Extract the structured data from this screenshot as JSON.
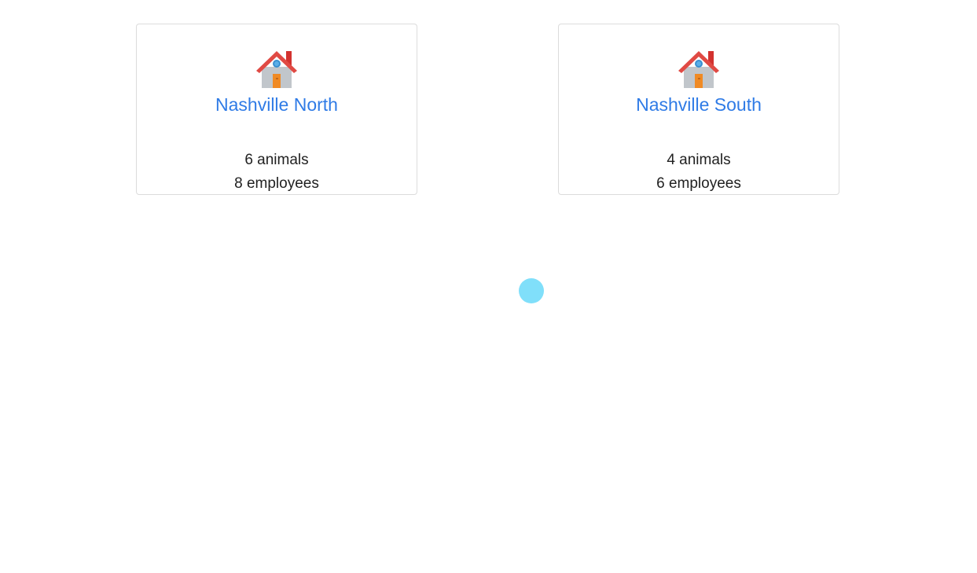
{
  "locations": [
    {
      "icon": "house-icon",
      "name": "Nashville North",
      "animals": "6 animals",
      "employees": "8 employees"
    },
    {
      "icon": "house-icon",
      "name": "Nashville South",
      "animals": "4 animals",
      "employees": "6 employees"
    }
  ],
  "colors": {
    "link": "#2f7be6",
    "text": "#212121",
    "border": "#dcdcdc",
    "indicator": "#80dffa"
  }
}
